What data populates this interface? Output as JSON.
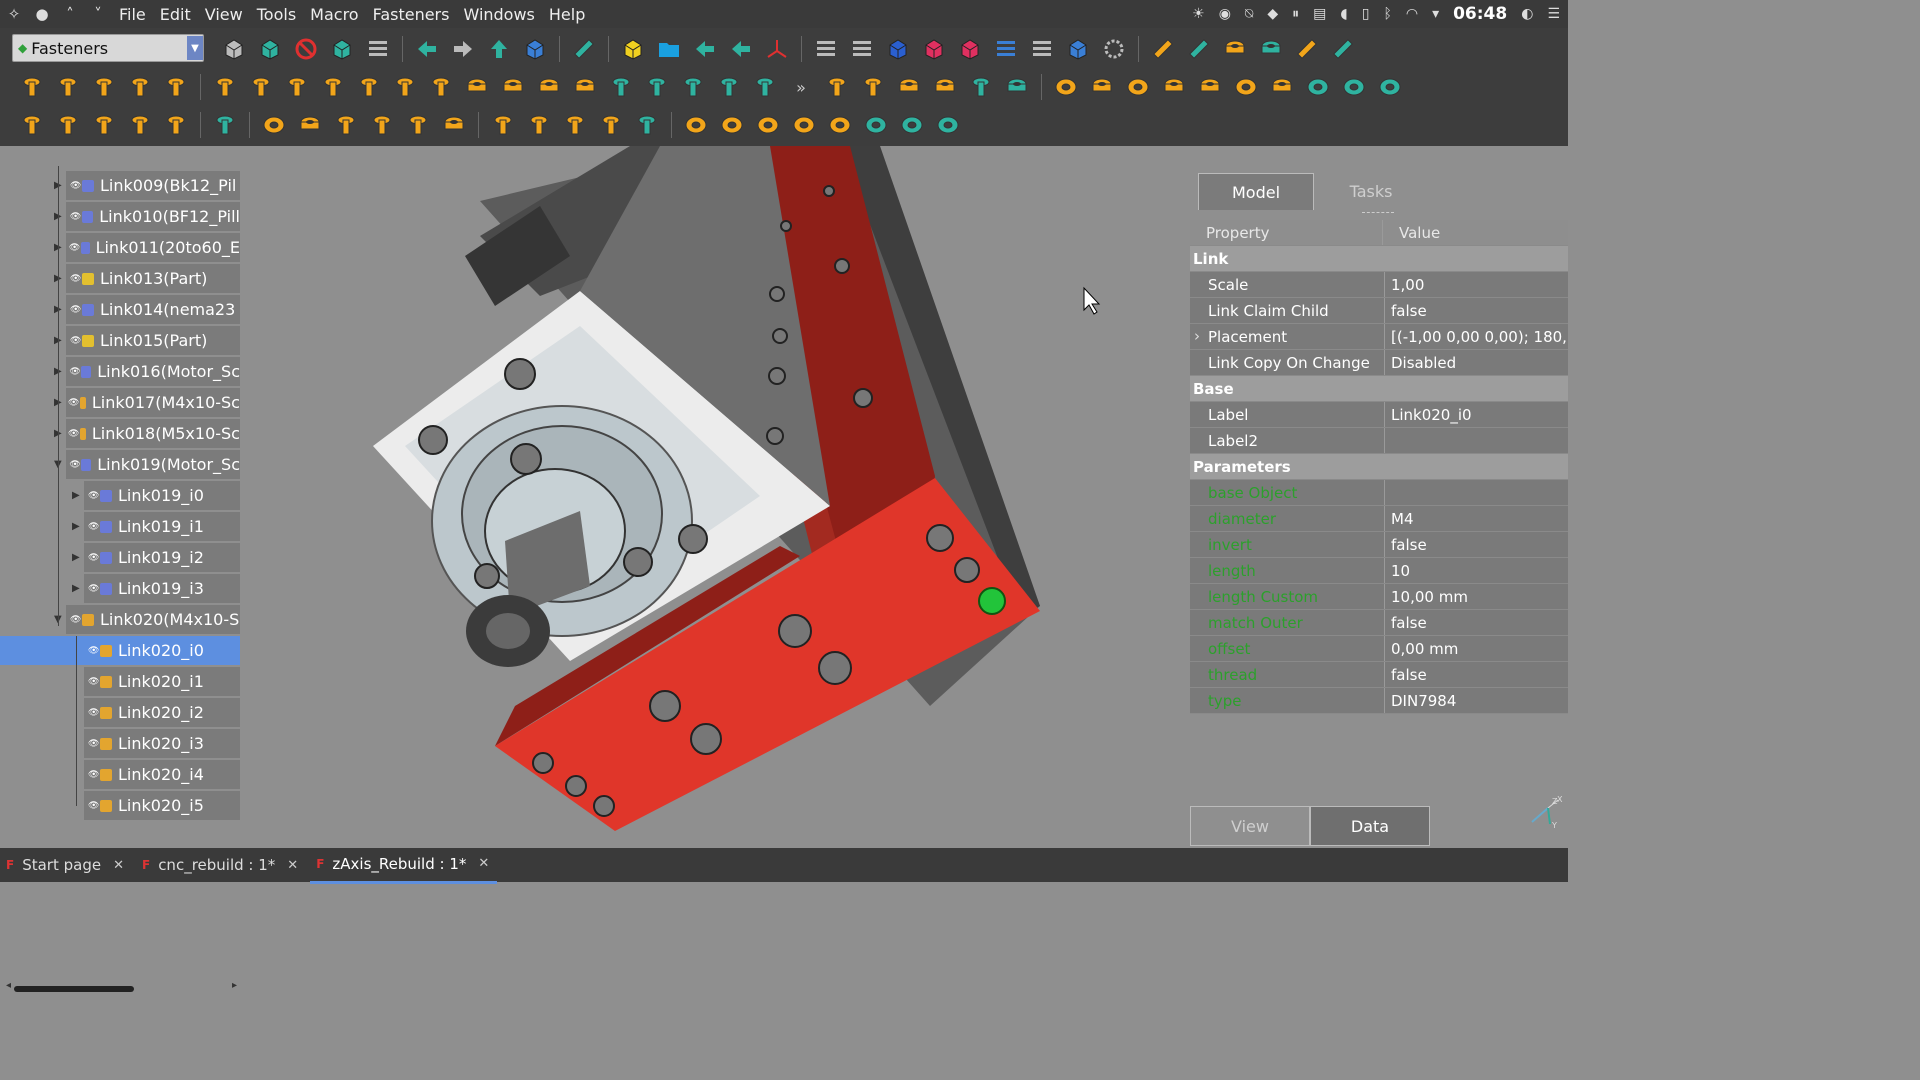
{
  "menubar": {
    "items": [
      "File",
      "Edit",
      "View",
      "Tools",
      "Macro",
      "Fasteners",
      "Windows",
      "Help"
    ],
    "clock": "06:48"
  },
  "toolbar": {
    "workbench": "Fasteners",
    "overflow": "»"
  },
  "tree": {
    "items": [
      {
        "label": "Link009(Bk12_Pil",
        "color": "#6a7ad8"
      },
      {
        "label": "Link010(BF12_Pill",
        "color": "#6a7ad8"
      },
      {
        "label": "Link011(20to60_E",
        "color": "#6a7ad8"
      },
      {
        "label": "Link013(Part)",
        "color": "#e3c02f"
      },
      {
        "label": "Link014(nema23",
        "color": "#6a7ad8"
      },
      {
        "label": "Link015(Part)",
        "color": "#e3c02f"
      },
      {
        "label": "Link016(Motor_Sc",
        "color": "#6a7ad8"
      },
      {
        "label": "Link017(M4x10-Sc",
        "color": "#e3a52f"
      },
      {
        "label": "Link018(M5x10-Sc",
        "color": "#e3a52f"
      },
      {
        "label": "Link019(Motor_Sc",
        "color": "#6a7ad8"
      },
      {
        "label": "Link019_i0",
        "color": "#6a7ad8"
      },
      {
        "label": "Link019_i1",
        "color": "#6a7ad8"
      },
      {
        "label": "Link019_i2",
        "color": "#6a7ad8"
      },
      {
        "label": "Link019_i3",
        "color": "#6a7ad8"
      },
      {
        "label": "Link020(M4x10-S",
        "color": "#e3a52f"
      },
      {
        "label": "Link020_i0",
        "color": "#e3a52f"
      },
      {
        "label": "Link020_i1",
        "color": "#e3a52f"
      },
      {
        "label": "Link020_i2",
        "color": "#e3a52f"
      },
      {
        "label": "Link020_i3",
        "color": "#e3a52f"
      },
      {
        "label": "Link020_i4",
        "color": "#e3a52f"
      },
      {
        "label": "Link020_i5",
        "color": "#e3a52f"
      }
    ],
    "selected": "Link020_i0"
  },
  "panel": {
    "tabs": [
      "Model",
      "Tasks"
    ],
    "header": {
      "property": "Property",
      "value": "Value"
    },
    "groups": [
      {
        "name": "Link",
        "rows": [
          {
            "k": "Scale",
            "v": "1,00"
          },
          {
            "k": "Link Claim Child",
            "v": "false"
          },
          {
            "k": "Placement",
            "v": "[(-1,00 0,00 0,00); 180,..."
          },
          {
            "k": "Link Copy On Change",
            "v": "Disabled"
          }
        ]
      },
      {
        "name": "Base",
        "rows": [
          {
            "k": "Label",
            "v": "Link020_i0"
          },
          {
            "k": "Label2",
            "v": ""
          }
        ]
      },
      {
        "name": "Parameters",
        "rows": [
          {
            "k": "base Object",
            "v": ""
          },
          {
            "k": "diameter",
            "v": "M4"
          },
          {
            "k": "invert",
            "v": "false"
          },
          {
            "k": "length",
            "v": "10"
          },
          {
            "k": "length Custom",
            "v": "10,00 mm"
          },
          {
            "k": "match Outer",
            "v": "false"
          },
          {
            "k": "offset",
            "v": "0,00 mm"
          },
          {
            "k": "thread",
            "v": "false"
          },
          {
            "k": "type",
            "v": "DIN7984"
          }
        ]
      }
    ],
    "bottom_tabs": [
      "View",
      "Data"
    ]
  },
  "doc_tabs": [
    "Start page",
    "cnc_rebuild : 1*",
    "zAxis_Rebuild : 1*"
  ],
  "colors": {
    "accent": "#5d8fe0",
    "part_red": "#e03a2a",
    "param_green": "#2ca02c"
  }
}
